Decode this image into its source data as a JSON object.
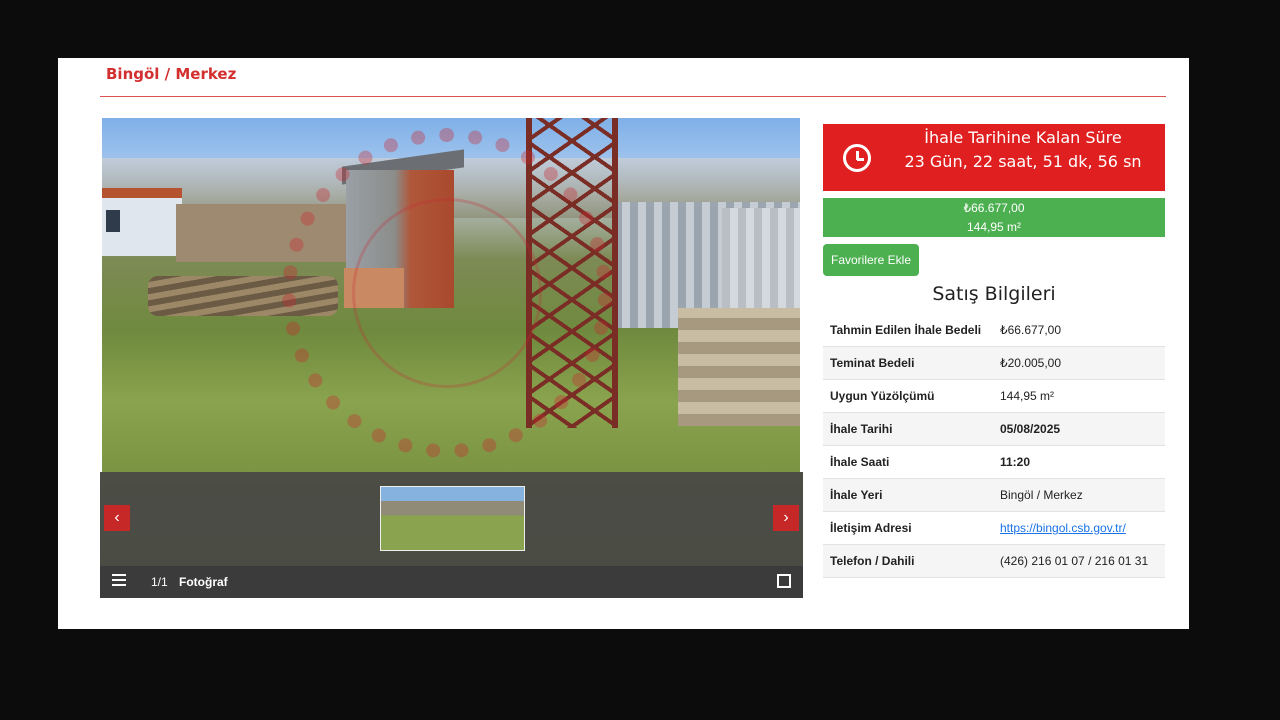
{
  "breadcrumb": "Bingöl / Merkez",
  "gallery": {
    "counter": "1/1",
    "caption": "Fotoğraf",
    "prev_icon": "chevron-left-icon",
    "next_icon": "chevron-right-icon",
    "prev_glyph": "‹",
    "next_glyph": "›"
  },
  "timer": {
    "title": "İhale Tarihine Kalan Süre",
    "value": "23 Gün, 22 saat, 51 dk, 56 sn",
    "color": "#e02020"
  },
  "price_box": {
    "price": "₺66.677,00",
    "area": "144,95 m²",
    "color": "#4caf50"
  },
  "favorite_button": "Favorilere Ekle",
  "sales_title": "Satış Bilgileri",
  "details": [
    {
      "label": "Tahmin Edilen İhale Bedeli",
      "value": "₺66.677,00"
    },
    {
      "label": "Teminat Bedeli",
      "value": "₺20.005,00"
    },
    {
      "label": "Uygun Yüzölçümü",
      "value": "144,95 m²"
    },
    {
      "label": "İhale Tarihi",
      "value": "05/08/2025"
    },
    {
      "label": "İhale Saati",
      "value": "11:20"
    },
    {
      "label": "İhale Yeri",
      "value": "Bingöl / Merkez"
    },
    {
      "label": "İletişim Adresi",
      "value": "https://bingol.csb.gov.tr/"
    },
    {
      "label": "Telefon / Dahili",
      "value": "(426) 216 01 07 / 216 01 31"
    }
  ]
}
